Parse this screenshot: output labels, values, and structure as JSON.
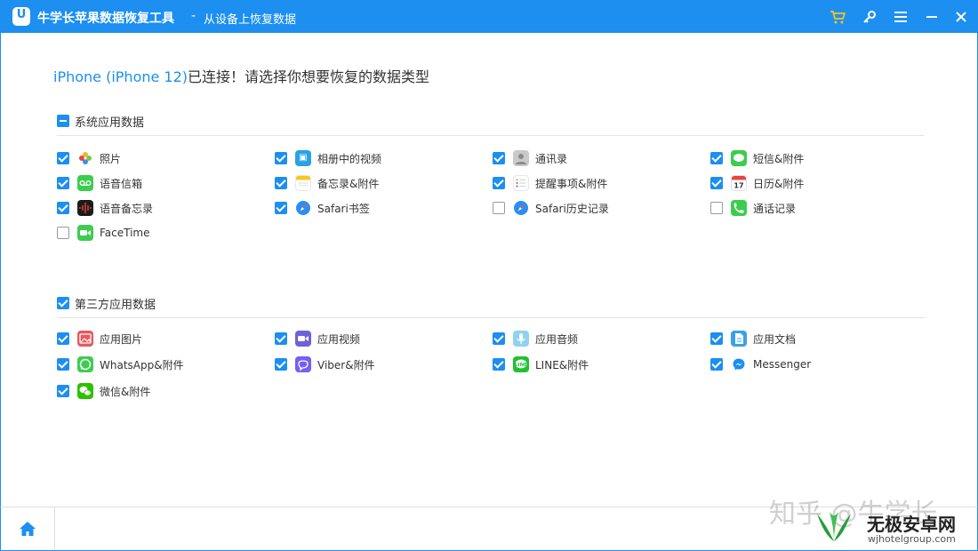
{
  "titlebar": {
    "app_title": "牛学长苹果数据恢复工具",
    "separator": "-",
    "page_subtitle": "从设备上恢复数据"
  },
  "header": {
    "device": "iPhone (iPhone 12)",
    "prompt": "已连接！请选择你想要恢复的数据类型"
  },
  "sections": {
    "system": {
      "title": "系统应用数据",
      "state": "partial",
      "items": [
        {
          "label": "照片",
          "checked": true,
          "icon": "photos-icon"
        },
        {
          "label": "相册中的视频",
          "checked": true,
          "icon": "album-video-icon"
        },
        {
          "label": "通讯录",
          "checked": true,
          "icon": "contacts-icon"
        },
        {
          "label": "短信&附件",
          "checked": true,
          "icon": "messages-icon"
        },
        {
          "label": "语音信箱",
          "checked": true,
          "icon": "voicemail-icon"
        },
        {
          "label": "备忘录&附件",
          "checked": true,
          "icon": "notes-icon"
        },
        {
          "label": "提醒事项&附件",
          "checked": true,
          "icon": "reminders-icon"
        },
        {
          "label": "日历&附件",
          "checked": true,
          "icon": "calendar-icon"
        },
        {
          "label": "语音备忘录",
          "checked": true,
          "icon": "voice-memos-icon"
        },
        {
          "label": "Safari书签",
          "checked": true,
          "icon": "safari-icon"
        },
        {
          "label": "Safari历史记录",
          "checked": false,
          "icon": "safari-icon"
        },
        {
          "label": "通话记录",
          "checked": false,
          "icon": "phone-icon"
        },
        {
          "label": "FaceTime",
          "checked": false,
          "icon": "facetime-icon"
        }
      ]
    },
    "thirdparty": {
      "title": "第三方应用数据",
      "state": "checked",
      "items": [
        {
          "label": "应用图片",
          "checked": true,
          "icon": "app-photos-icon"
        },
        {
          "label": "应用视频",
          "checked": true,
          "icon": "app-video-icon"
        },
        {
          "label": "应用音频",
          "checked": true,
          "icon": "app-audio-icon"
        },
        {
          "label": "应用文档",
          "checked": true,
          "icon": "app-documents-icon"
        },
        {
          "label": "WhatsApp&附件",
          "checked": true,
          "icon": "whatsapp-icon"
        },
        {
          "label": "Viber&附件",
          "checked": true,
          "icon": "viber-icon"
        },
        {
          "label": "LINE&附件",
          "checked": true,
          "icon": "line-icon"
        },
        {
          "label": "Messenger",
          "checked": true,
          "icon": "messenger-icon"
        },
        {
          "label": "微信&附件",
          "checked": true,
          "icon": "wechat-icon"
        }
      ]
    }
  },
  "watermark": {
    "zhihu": "知乎 @牛学长",
    "site_name": "无极安卓网",
    "site_url": "wjhotelgroup.com"
  },
  "colors": {
    "accent": "#1c8ff0",
    "checkbox_on": "#1c8ff0",
    "divider": "#e3e3e3"
  }
}
